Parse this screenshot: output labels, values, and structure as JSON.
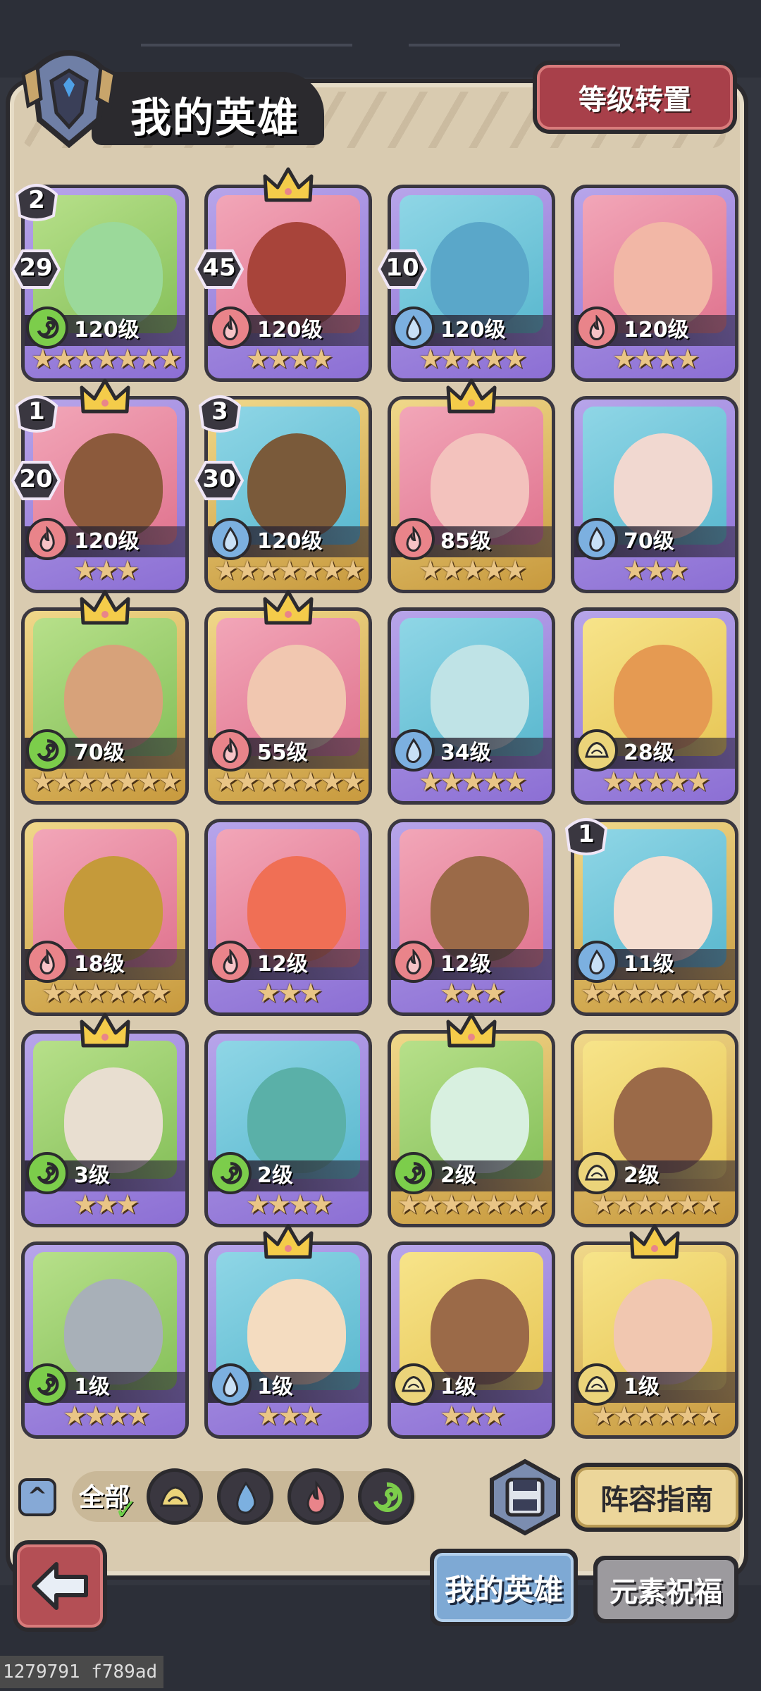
{
  "header": {
    "title": "我的英雄",
    "level_reset_label": "等级转置"
  },
  "heroes": [
    {
      "level": "120级",
      "stars": 7,
      "element": "nature",
      "frame": "purple",
      "art": "green",
      "face": "#9bd99a",
      "hex": "29",
      "round": "2",
      "crown": false
    },
    {
      "level": "120级",
      "stars": 4,
      "element": "fire",
      "frame": "purple",
      "art": "pink",
      "face": "#a8443a",
      "hex": "45",
      "round": "",
      "crown": true
    },
    {
      "level": "120级",
      "stars": 5,
      "element": "water",
      "frame": "purple",
      "art": "teal",
      "face": "#5aa7c9",
      "hex": "10",
      "round": "",
      "crown": false
    },
    {
      "level": "120级",
      "stars": 4,
      "element": "fire",
      "frame": "purple",
      "art": "pink",
      "face": "#f2b7a6",
      "hex": "",
      "round": "",
      "crown": false
    },
    {
      "level": "120级",
      "stars": 3,
      "element": "fire",
      "frame": "purple",
      "art": "pink",
      "face": "#8c5a3c",
      "hex": "20",
      "round": "1",
      "crown": true
    },
    {
      "level": "120级",
      "stars": 7,
      "element": "water",
      "frame": "gold",
      "art": "teal",
      "face": "#7a5a3a",
      "hex": "30",
      "round": "3",
      "crown": false
    },
    {
      "level": "85级",
      "stars": 5,
      "element": "fire",
      "frame": "gold",
      "art": "pink",
      "face": "#f3c2bd",
      "hex": "",
      "round": "",
      "crown": true
    },
    {
      "level": "70级",
      "stars": 3,
      "element": "water",
      "frame": "purple",
      "art": "teal",
      "face": "#f1d8d0",
      "hex": "",
      "round": "",
      "crown": false
    },
    {
      "level": "70级",
      "stars": 7,
      "element": "nature",
      "frame": "gold",
      "art": "green",
      "face": "#d7a27a",
      "hex": "",
      "round": "",
      "crown": true
    },
    {
      "level": "55级",
      "stars": 7,
      "element": "fire",
      "frame": "gold",
      "art": "pink",
      "face": "#f1c7b0",
      "hex": "",
      "round": "",
      "crown": true
    },
    {
      "level": "34级",
      "stars": 5,
      "element": "water",
      "frame": "purple",
      "art": "teal",
      "face": "#bfe3e6",
      "hex": "",
      "round": "",
      "crown": false
    },
    {
      "level": "28级",
      "stars": 5,
      "element": "earth",
      "frame": "purple",
      "art": "yellow",
      "face": "#e59a52",
      "hex": "",
      "round": "",
      "crown": false
    },
    {
      "level": "18级",
      "stars": 6,
      "element": "fire",
      "frame": "gold",
      "art": "pink",
      "face": "#c59a3a",
      "hex": "",
      "round": "",
      "crown": false
    },
    {
      "level": "12级",
      "stars": 3,
      "element": "fire",
      "frame": "purple",
      "art": "pink",
      "face": "#f06f55",
      "hex": "",
      "round": "",
      "crown": false
    },
    {
      "level": "12级",
      "stars": 3,
      "element": "fire",
      "frame": "purple",
      "art": "pink",
      "face": "#9b6a48",
      "hex": "",
      "round": "",
      "crown": false
    },
    {
      "level": "11级",
      "stars": 7,
      "element": "water",
      "frame": "gold",
      "art": "teal",
      "face": "#f4ddd0",
      "hex": "",
      "round": "1",
      "crown": false
    },
    {
      "level": "3级",
      "stars": 3,
      "element": "nature",
      "frame": "purple",
      "art": "green",
      "face": "#e8ded0",
      "hex": "",
      "round": "",
      "crown": true
    },
    {
      "level": "2级",
      "stars": 4,
      "element": "nature",
      "frame": "purple",
      "art": "teal",
      "face": "#5ab0a8",
      "hex": "",
      "round": "",
      "crown": false
    },
    {
      "level": "2级",
      "stars": 7,
      "element": "nature",
      "frame": "gold",
      "art": "green",
      "face": "#d8f0e0",
      "hex": "",
      "round": "",
      "crown": true
    },
    {
      "level": "2级",
      "stars": 6,
      "element": "earth",
      "frame": "gold",
      "art": "yellow",
      "face": "#9b6a48",
      "hex": "",
      "round": "",
      "crown": false
    },
    {
      "level": "1级",
      "stars": 4,
      "element": "nature",
      "frame": "purple",
      "art": "green",
      "face": "#a8b0b8",
      "hex": "",
      "round": "",
      "crown": false
    },
    {
      "level": "1级",
      "stars": 3,
      "element": "water",
      "frame": "purple",
      "art": "teal",
      "face": "#f4dcc0",
      "hex": "",
      "round": "",
      "crown": true
    },
    {
      "level": "1级",
      "stars": 3,
      "element": "earth",
      "frame": "purple",
      "art": "yellow",
      "face": "#9b6a48",
      "hex": "",
      "round": "",
      "crown": false
    },
    {
      "level": "1级",
      "stars": 6,
      "element": "earth",
      "frame": "gold",
      "art": "yellow",
      "face": "#f1c7b0",
      "hex": "",
      "round": "",
      "crown": true
    }
  ],
  "filters": {
    "all_label": "全部",
    "items": [
      "earth",
      "water",
      "fire",
      "nature"
    ]
  },
  "buttons": {
    "lineup_guide": "阵容指南",
    "tab_my_heroes": "我的英雄",
    "tab_element_blessing": "元素祝福"
  },
  "debug_text": "1279791 f789ad"
}
